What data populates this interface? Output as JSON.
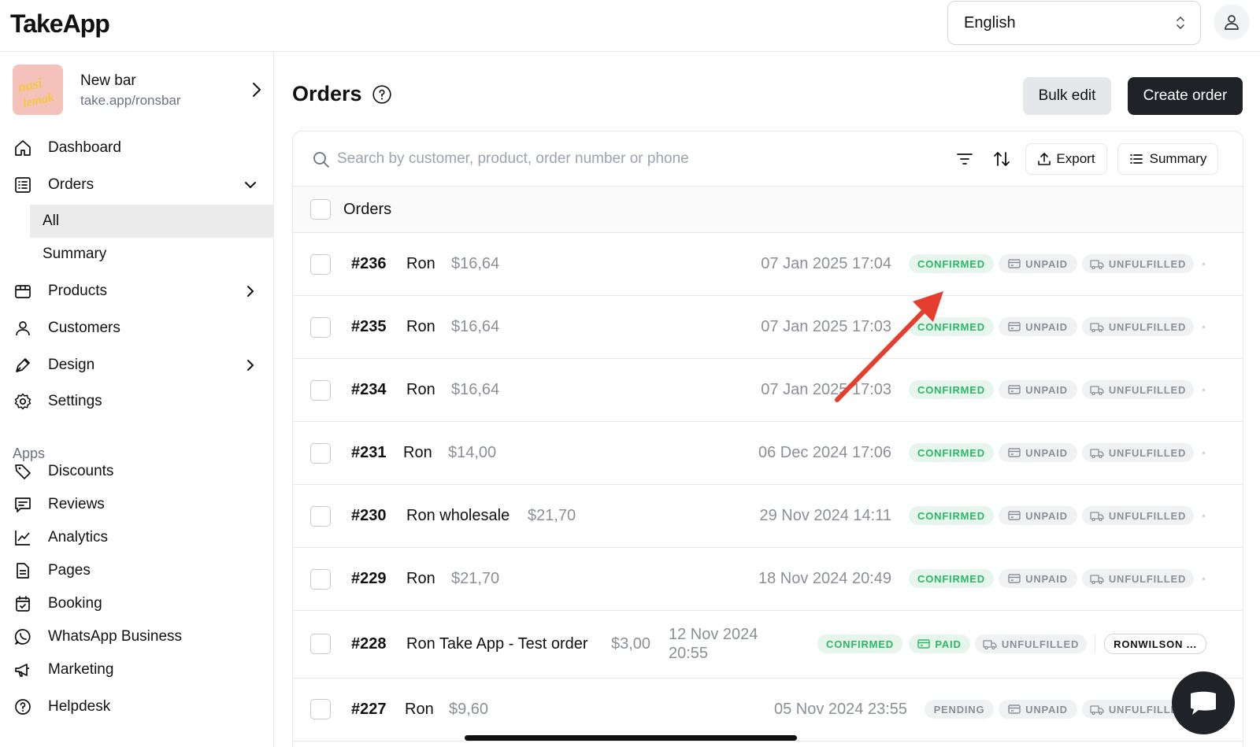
{
  "app": {
    "logo": "TakeApp"
  },
  "topbar": {
    "language": "English"
  },
  "store": {
    "name": "New bar",
    "url": "take.app/ronsbar",
    "avatar_text": "nasi lemak"
  },
  "nav": {
    "dashboard": "Dashboard",
    "orders": "Orders",
    "orders_all": "All",
    "orders_summary": "Summary",
    "products": "Products",
    "customers": "Customers",
    "design": "Design",
    "settings": "Settings",
    "apps_label": "Apps",
    "discounts": "Discounts",
    "reviews": "Reviews",
    "analytics": "Analytics",
    "pages": "Pages",
    "booking": "Booking",
    "whatsapp": "WhatsApp Business",
    "marketing": "Marketing",
    "helpdesk": "Helpdesk"
  },
  "page": {
    "title": "Orders",
    "bulk_edit": "Bulk edit",
    "create_order": "Create order",
    "search_placeholder": "Search by customer, product, order number or phone",
    "export": "Export",
    "summary": "Summary",
    "header_label": "Orders"
  },
  "orders": [
    {
      "num": "#236",
      "name": "Ron",
      "price": "$16,64",
      "date": "07 Jan 2025 17:04",
      "status": "CONFIRMED",
      "payment": "UNPAID",
      "fulfillment": "UNFULFILLED"
    },
    {
      "num": "#235",
      "name": "Ron",
      "price": "$16,64",
      "date": "07 Jan 2025 17:03",
      "status": "CONFIRMED",
      "payment": "UNPAID",
      "fulfillment": "UNFULFILLED"
    },
    {
      "num": "#234",
      "name": "Ron",
      "price": "$16,64",
      "date": "07 Jan 2025 17:03",
      "status": "CONFIRMED",
      "payment": "UNPAID",
      "fulfillment": "UNFULFILLED"
    },
    {
      "num": "#231",
      "name": "Ron",
      "price": "$14,00",
      "date": "06 Dec 2024 17:06",
      "status": "CONFIRMED",
      "payment": "UNPAID",
      "fulfillment": "UNFULFILLED"
    },
    {
      "num": "#230",
      "name": "Ron wholesale",
      "price": "$21,70",
      "date": "29 Nov 2024 14:11",
      "status": "CONFIRMED",
      "payment": "UNPAID",
      "fulfillment": "UNFULFILLED"
    },
    {
      "num": "#229",
      "name": "Ron",
      "price": "$21,70",
      "date": "18 Nov 2024 20:49",
      "status": "CONFIRMED",
      "payment": "UNPAID",
      "fulfillment": "UNFULFILLED"
    },
    {
      "num": "#228",
      "name": "Ron Take App - Test order",
      "price": "$3,00",
      "date_line1": "12 Nov 2024",
      "date_line2": "20:55",
      "status": "CONFIRMED",
      "payment": "PAID",
      "fulfillment": "UNFULFILLED",
      "tag": "RONWILSON ..."
    },
    {
      "num": "#227",
      "name": "Ron",
      "price": "$9,60",
      "date": "05 Nov 2024 23:55",
      "status": "PENDING",
      "payment": "UNPAID",
      "fulfillment": "UNFULFILLED"
    }
  ],
  "colors": {
    "accent_dark": "#1f2328",
    "confirmed_green": "#2bb866",
    "annotation_red": "#e53e30"
  }
}
